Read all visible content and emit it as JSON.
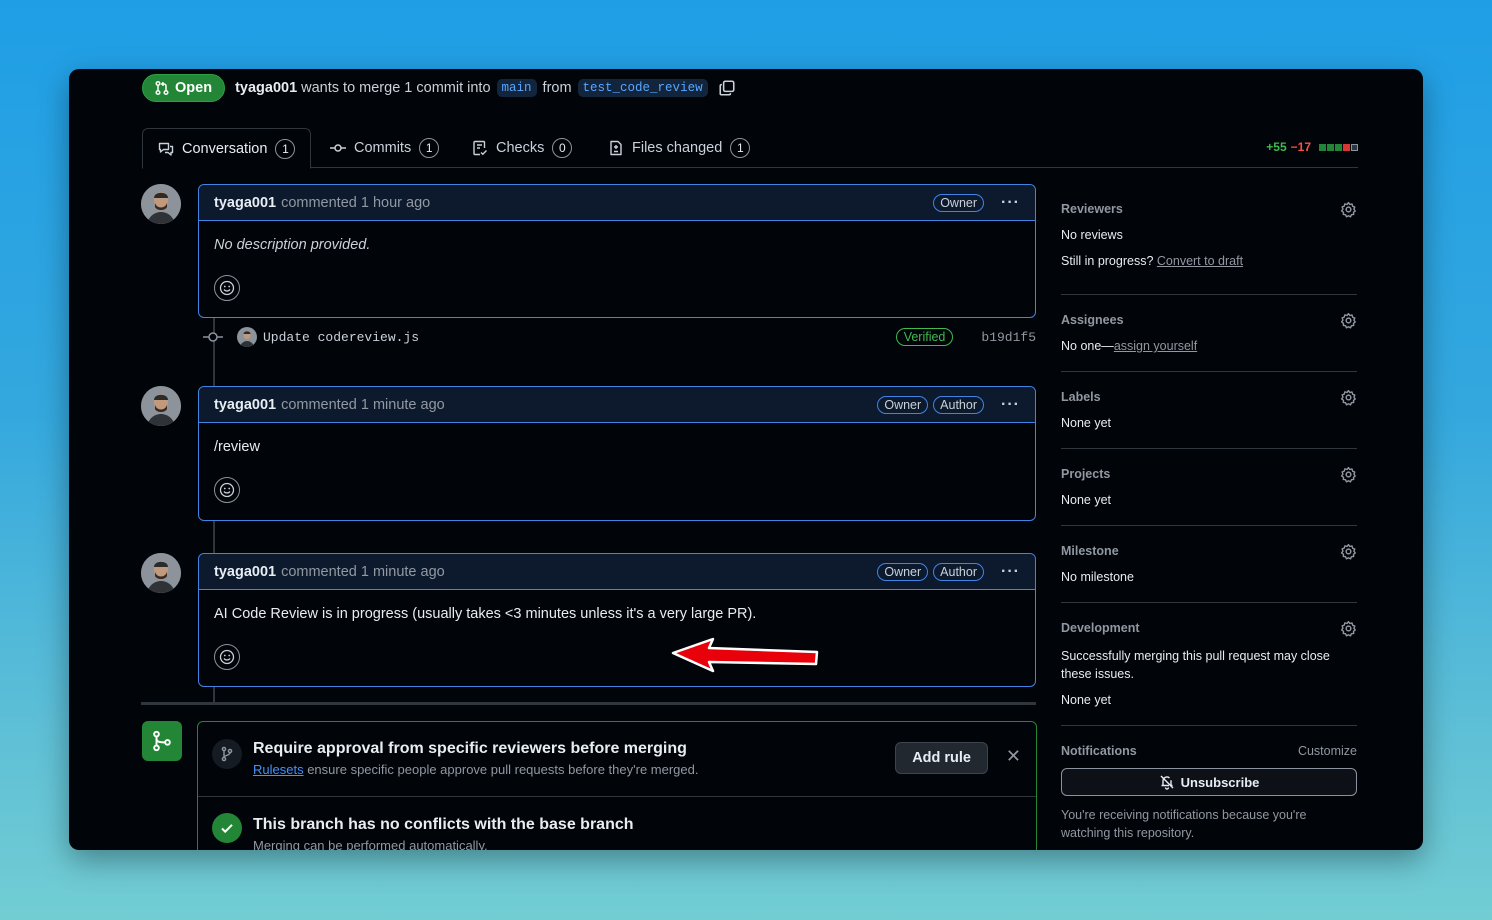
{
  "header": {
    "state": "Open",
    "author": "tyaga001",
    "action_text": "wants to merge 1 commit into",
    "base_branch": "main",
    "from_text": "from",
    "head_branch": "test_code_review"
  },
  "tabs": [
    {
      "label": "Conversation",
      "count": "1"
    },
    {
      "label": "Commits",
      "count": "1"
    },
    {
      "label": "Checks",
      "count": "0"
    },
    {
      "label": "Files changed",
      "count": "1"
    }
  ],
  "diffstat": {
    "additions": "+55",
    "deletions": "−17"
  },
  "comments": [
    {
      "author": "tyaga001",
      "meta": "commented 1 hour ago",
      "roles": [
        "Owner"
      ],
      "body": "No description provided."
    },
    {
      "author": "tyaga001",
      "meta": "commented 1 minute ago",
      "roles": [
        "Owner",
        "Author"
      ],
      "body": "/review"
    },
    {
      "author": "tyaga001",
      "meta": "commented 1 minute ago",
      "roles": [
        "Owner",
        "Author"
      ],
      "body": "AI Code Review is in progress (usually takes <3 minutes unless it's a very large PR)."
    }
  ],
  "commit": {
    "message": "Update codereview.js",
    "badge": "Verified",
    "sha": "b19d1f5"
  },
  "merge": {
    "rule_title": "Require approval from specific reviewers before merging",
    "rule_link": "Rulesets",
    "rule_text": "ensure specific people approve pull requests before they're merged.",
    "add_rule": "Add rule",
    "conflict_title": "This branch has no conflicts with the base branch",
    "conflict_sub": "Merging can be performed automatically."
  },
  "sidebar": {
    "reviewers": {
      "title": "Reviewers",
      "value": "No reviews",
      "draft_prefix": "Still in progress?",
      "draft_link": "Convert to draft"
    },
    "assignees": {
      "title": "Assignees",
      "value": "No one—",
      "link": "assign yourself"
    },
    "labels": {
      "title": "Labels",
      "value": "None yet"
    },
    "projects": {
      "title": "Projects",
      "value": "None yet"
    },
    "milestone": {
      "title": "Milestone",
      "value": "No milestone"
    },
    "development": {
      "title": "Development",
      "desc": "Successfully merging this pull request may close these issues.",
      "value": "None yet"
    },
    "notifications": {
      "title": "Notifications",
      "customize": "Customize",
      "button": "Unsubscribe",
      "desc": "You're receiving notifications because you're watching this repository."
    }
  },
  "colors": {
    "accent": "#4184e4",
    "success": "#238636",
    "arrow": "#e8000b"
  }
}
